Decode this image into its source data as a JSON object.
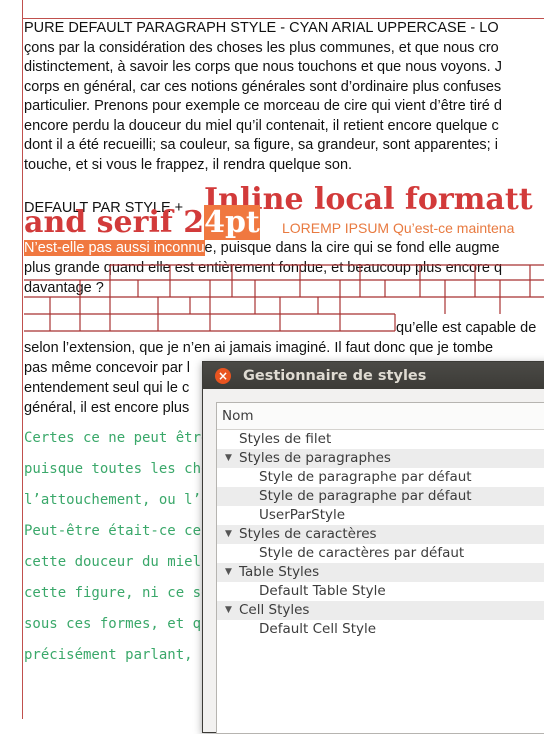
{
  "document": {
    "paragraph1_lines": [
      "PURE DEFAULT PARAGRAPH STYLE - CYAN ARIAL UPPERCASE - LO",
      "çons par la considération des choses les plus communes, et que nous cro",
      "distinctement, à savoir les corps que nous touchons et que nous voyons. J",
      "corps en général, car ces notions générales sont d’ordinaire plus confuses",
      "particulier. Prenons pour exemple ce morceau de cire qui vient d’être tiré d",
      "encore perdu la douceur du miel qu’il contenait, il retient encore quelque c",
      "dont il a été recueilli; sa couleur, sa figure, sa grandeur, sont apparentes; i",
      "touche, et si vous le frappez, il rendra quelque son."
    ],
    "para2": {
      "prefix": "DEFAULT PAR STYLE + ",
      "inline_big": "Inline local formatt",
      "big_line2": "and serif 2",
      "big_line2_hl": "4pt",
      "lorem": " LOREMP IPSUM Qu’est-ce maintena",
      "line3_hl": "N’est-elle pas aussi inconnu",
      "line3_rest": "e, puisque dans la cire qui se fond elle augme",
      "line4": "plus grande quand elle est entièrement fondue, et beaucoup plus encore q",
      "line5": "davantage ?",
      "line6_tail": "qu’elle est capable de",
      "line7": "selon l’extension, que je n’en ai jamais imaginé. Il faut donc que je tombe",
      "line8": "pas même concevoir par l",
      "line9": "entendement seul qui le c",
      "line10": "général, il est encore plus"
    },
    "mono_lines": [
      "Certes ce ne peut être",
      "puisque toutes les cho",
      "l’attouchement, ou l’o",
      "Peut-être était-ce ce",
      "cette douceur du miel,",
      "cette figure, ni ce so",
      "sous ces formes, et qu",
      "précisément parlant, c"
    ]
  },
  "dialog": {
    "title": "Gestionnaire de styles",
    "close_glyph": "×",
    "column_header": "Nom",
    "tree": [
      {
        "label": "Styles de filet",
        "level": 0,
        "expander": ""
      },
      {
        "label": "Styles de paragraphes",
        "level": 0,
        "expander": "▼"
      },
      {
        "label": "Style de paragraphe par défaut",
        "level": 1,
        "expander": ""
      },
      {
        "label": "Style de paragraphe par défaut",
        "level": 1,
        "expander": ""
      },
      {
        "label": "UserParStyle",
        "level": 1,
        "expander": ""
      },
      {
        "label": "Styles de caractères",
        "level": 0,
        "expander": "▼"
      },
      {
        "label": "Style de caractères par défaut",
        "level": 1,
        "expander": ""
      },
      {
        "label": "Table Styles",
        "level": 0,
        "expander": "▼"
      },
      {
        "label": "Default Table Style",
        "level": 1,
        "expander": ""
      },
      {
        "label": "Cell Styles",
        "level": 0,
        "expander": "▼"
      },
      {
        "label": "Default Cell Style",
        "level": 1,
        "expander": ""
      }
    ]
  },
  "colors": {
    "margin_guide": "#c0504d",
    "inline_heading": "#d23a3a",
    "highlight": "#f07840",
    "mono_text": "#3aa86a",
    "titlebar": "#3c3b37",
    "close_button": "#e95420"
  }
}
